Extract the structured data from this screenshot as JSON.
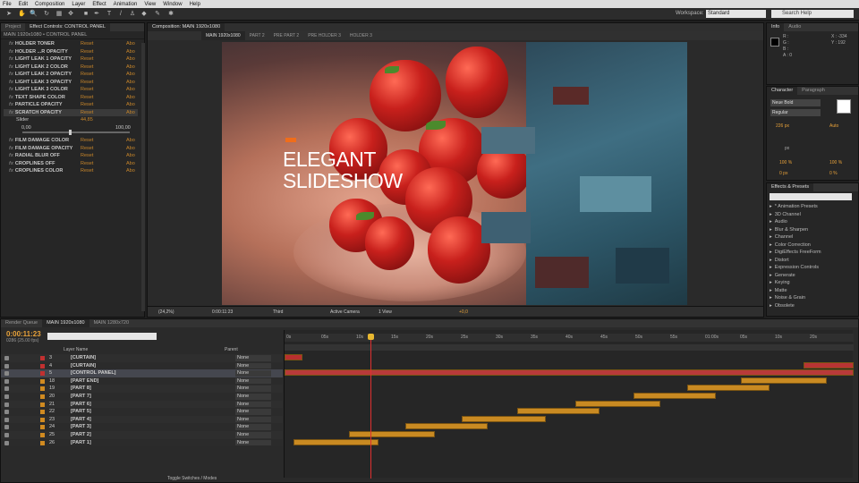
{
  "menu": [
    "File",
    "Edit",
    "Composition",
    "Layer",
    "Effect",
    "Animation",
    "View",
    "Window",
    "Help"
  ],
  "toolbar": {
    "workspace_label": "Workspace:",
    "workspace_value": "Standard",
    "search_help": "Search Help"
  },
  "project_panel": {
    "tabs": [
      "Project",
      "Effect Controls: CONTROL PANEL"
    ],
    "breadcrumb": "MAIN 1920x1080 • CONTROL PANEL",
    "effects": [
      {
        "name": "HOLDER TONER",
        "reset": "Reset",
        "about": "Abo"
      },
      {
        "name": "HOLDER ...R OPACITY",
        "reset": "Reset",
        "about": "Abo"
      },
      {
        "name": "LIGHT LEAK 1 OPACITY",
        "reset": "Reset",
        "about": "Abo"
      },
      {
        "name": "LIGHT LEAK 2 COLOR",
        "reset": "Reset",
        "about": "Abo"
      },
      {
        "name": "LIGHT LEAK 2 OPACITY",
        "reset": "Reset",
        "about": "Abo"
      },
      {
        "name": "LIGHT LEAK 3 OPACITY",
        "reset": "Reset",
        "about": "Abo"
      },
      {
        "name": "LIGHT LEAK 3 COLOR",
        "reset": "Reset",
        "about": "Abo"
      },
      {
        "name": "TEXT SHAPE COLOR",
        "reset": "Reset",
        "about": "Abo"
      },
      {
        "name": "PARTICLE OPACITY",
        "reset": "Reset",
        "about": "Abo"
      },
      {
        "name": "SCRATCH OPACITY",
        "reset": "Reset",
        "about": "Abo"
      }
    ],
    "slider": {
      "label": "Slider",
      "value": "44,85",
      "min": "0,00",
      "max": "100,00"
    },
    "effects2": [
      {
        "name": "FILM DAMAGE COLOR",
        "reset": "Reset",
        "about": "Abo"
      },
      {
        "name": "FILM DAMAGE OPACITY",
        "reset": "Reset",
        "about": "Abo"
      },
      {
        "name": "RADIAL BLUR OFF",
        "reset": "Reset",
        "about": "Abo"
      },
      {
        "name": "CROPLINES OFF",
        "reset": "Reset",
        "about": "Abo"
      },
      {
        "name": "CROPLINES COLOR",
        "reset": "Reset",
        "about": "Abo"
      }
    ]
  },
  "composition": {
    "panel_tab": "Composition: MAIN 1920x1080",
    "subtabs": [
      "MAIN 1920x1080",
      "PART 2",
      "PRE PART 2",
      "PRE HOLDER 3",
      "HOLDER 3"
    ],
    "title_line1": "ELEGANT",
    "title_line2": "SLIDESHOW",
    "footer": {
      "zoom": "(24,2%)",
      "time": "0:00:11:23",
      "quality": "Third",
      "camera": "Active Camera",
      "view": "1 View",
      "exposure": "+0,0"
    }
  },
  "info": {
    "tabs": [
      "Info",
      "Audio"
    ],
    "r": "R :",
    "g": "G :",
    "b": "B :",
    "a": "A : 0",
    "x": "X : -334",
    "y": "Y : 192"
  },
  "character": {
    "tabs": [
      "Character",
      "Paragraph"
    ],
    "font": "Neue Bold",
    "style": "Regular",
    "size": "226 px",
    "leading": "Auto",
    "tracking": "px",
    "scale_v": "100 %",
    "scale_h": "100 %",
    "baseline": "0 px",
    "tsume": "0 %"
  },
  "effects_presets": {
    "tabs": [
      "Effects & Presets"
    ],
    "search_placeholder": "",
    "items": [
      "* Animation Presets",
      "3D Channel",
      "Audio",
      "Blur & Sharpen",
      "Channel",
      "Color Correction",
      "DigiEffects FreeForm",
      "Distort",
      "Expression Controls",
      "Generate",
      "Keying",
      "Matte",
      "Noise & Grain",
      "Obsolete"
    ]
  },
  "timeline": {
    "tabs": [
      "Render Queue",
      "MAIN 1920x1080",
      "MAIN 1280x720"
    ],
    "timecode": "0:00:11:23",
    "frame": "0286 (25.00 fps)",
    "col_source": "Layer Name",
    "col_parent": "Parent",
    "layers": [
      {
        "num": "3",
        "name": "[CURTAIN]",
        "parent": "None",
        "color": "#c23030"
      },
      {
        "num": "4",
        "name": "[CURTAIN]",
        "parent": "None",
        "color": "#c23030"
      },
      {
        "num": "5",
        "name": "[CONTROL PANEL]",
        "parent": "None",
        "color": "#c23030"
      },
      {
        "num": "18",
        "name": "[PART END]",
        "parent": "None",
        "color": "#d08a20"
      },
      {
        "num": "19",
        "name": "[PART 8]",
        "parent": "None",
        "color": "#d08a20"
      },
      {
        "num": "20",
        "name": "[PART 7]",
        "parent": "None",
        "color": "#d08a20"
      },
      {
        "num": "21",
        "name": "[PART 6]",
        "parent": "None",
        "color": "#d08a20"
      },
      {
        "num": "22",
        "name": "[PART 5]",
        "parent": "None",
        "color": "#d08a20"
      },
      {
        "num": "23",
        "name": "[PART 4]",
        "parent": "None",
        "color": "#d08a20"
      },
      {
        "num": "24",
        "name": "[PART 3]",
        "parent": "None",
        "color": "#d08a20"
      },
      {
        "num": "25",
        "name": "[PART 2]",
        "parent": "None",
        "color": "#d08a20"
      },
      {
        "num": "26",
        "name": "[PART 1]",
        "parent": "None",
        "color": "#d08a20"
      }
    ],
    "ruler": [
      "0s",
      "05s",
      "10s",
      "15s",
      "20s",
      "25s",
      "30s",
      "35s",
      "40s",
      "45s",
      "50s",
      "55s",
      "01:00s",
      "05s",
      "10s",
      "20s"
    ],
    "toggle_label": "Toggle Switches / Modes"
  }
}
